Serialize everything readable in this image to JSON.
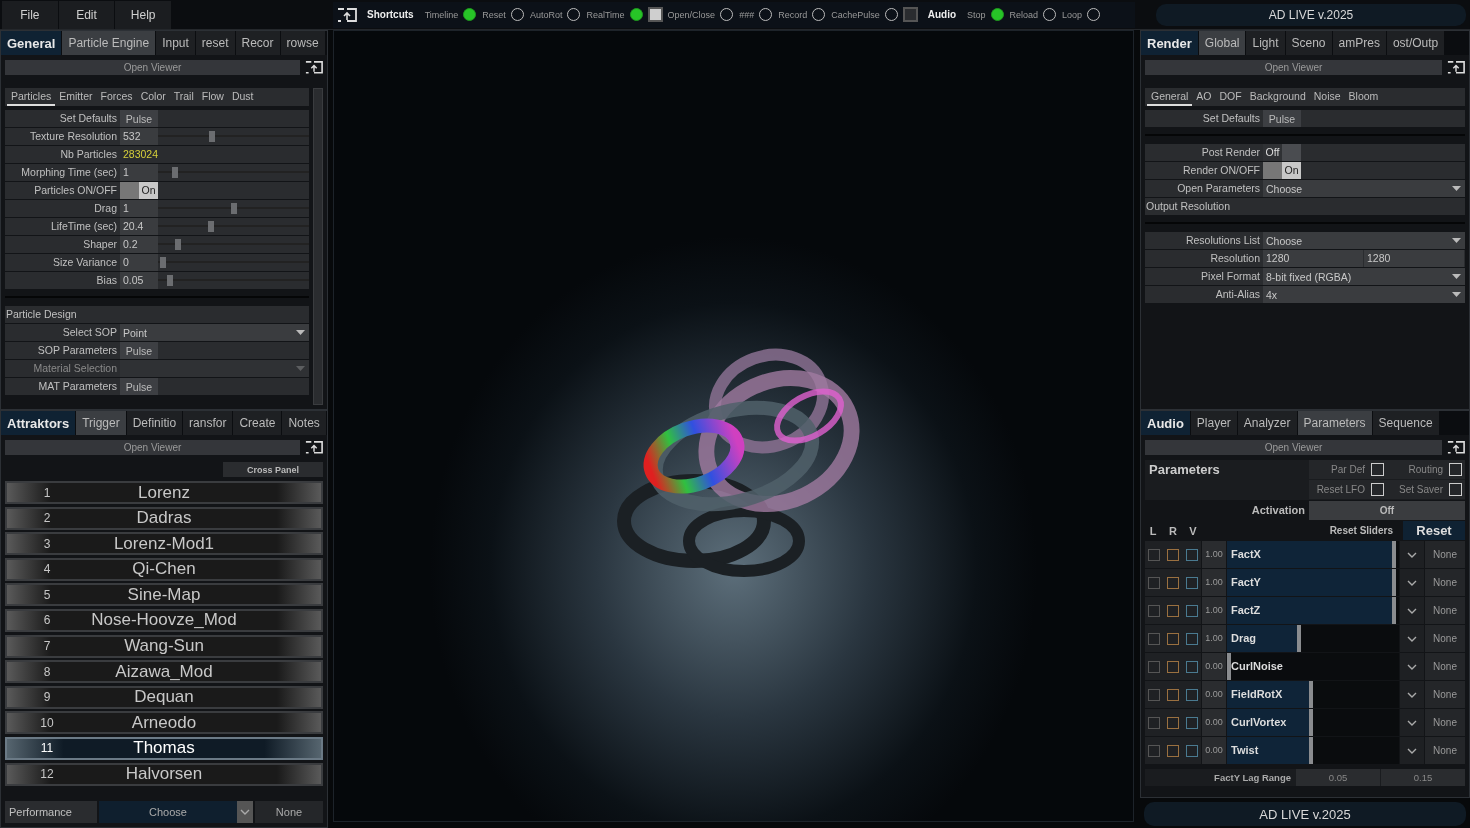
{
  "menu": [
    {
      "label": "File"
    },
    {
      "label": "Edit"
    },
    {
      "label": "Help"
    }
  ],
  "shortcuts": [
    {
      "kind": "heading",
      "label": "Shortcuts"
    },
    {
      "kind": "toggle",
      "label": "Timeline",
      "on": true
    },
    {
      "kind": "toggle",
      "label": "Reset",
      "on": false
    },
    {
      "kind": "toggle",
      "label": "AutoRot",
      "on": false
    },
    {
      "kind": "toggle",
      "label": "RealTime",
      "on": true
    },
    {
      "kind": "square",
      "checked": true
    },
    {
      "kind": "toggle",
      "label": "Open/Close",
      "on": false
    },
    {
      "kind": "toggle",
      "label": "###",
      "on": false
    },
    {
      "kind": "toggle",
      "label": "Record",
      "on": false
    },
    {
      "kind": "toggle",
      "label": "CachePulse",
      "on": false
    },
    {
      "kind": "square",
      "checked": false
    },
    {
      "kind": "heading",
      "label": "Audio"
    },
    {
      "kind": "toggle",
      "label": "Stop",
      "on": true
    },
    {
      "kind": "toggle",
      "label": "Reload",
      "on": false
    },
    {
      "kind": "toggle",
      "label": "Loop",
      "on": false
    }
  ],
  "banner": "AD LIVE v.2025",
  "particle_panel": {
    "title": "General",
    "tabs": [
      {
        "label": "Particle Engine",
        "selected": true
      },
      {
        "label": "Input",
        "selected": false
      },
      {
        "label": "reset",
        "selected": false
      },
      {
        "label": "Recor",
        "selected": false
      },
      {
        "label": "rowse",
        "selected": false
      }
    ],
    "viewer_button": "Open Viewer",
    "subtabs": [
      {
        "label": "Particles",
        "selected": true
      },
      {
        "label": "Emitter",
        "selected": false
      },
      {
        "label": "Forces",
        "selected": false
      },
      {
        "label": "Color",
        "selected": false
      },
      {
        "label": "Trail",
        "selected": false
      },
      {
        "label": "Flow",
        "selected": false
      },
      {
        "label": "Dust",
        "selected": false
      }
    ],
    "groups": [
      [
        {
          "kind": "pulse",
          "label": "Set Defaults",
          "value": "Pulse"
        },
        {
          "kind": "slider",
          "label": "Texture Resolution",
          "value": "532",
          "level": 0.36
        },
        {
          "kind": "readout",
          "label": "Nb Particles",
          "value": "283024"
        },
        {
          "kind": "slider",
          "label": "Morphing Time (sec)",
          "value": "1",
          "level": 0.11
        },
        {
          "kind": "toggle",
          "label": "Particles ON/OFF",
          "value": "On",
          "on": true
        },
        {
          "kind": "slider",
          "label": "Drag",
          "value": "1",
          "level": 0.5
        },
        {
          "kind": "slider",
          "label": "LifeTime (sec)",
          "value": "20.4",
          "level": 0.35
        },
        {
          "kind": "slider",
          "label": "Shaper",
          "value": "0.2",
          "level": 0.13
        },
        {
          "kind": "slider",
          "label": "Size Variance",
          "value": "0",
          "level": 0.03
        },
        {
          "kind": "slider",
          "label": "Bias",
          "value": "0.05",
          "level": 0.08
        }
      ],
      [
        {
          "kind": "section",
          "label": "Particle Design"
        },
        {
          "kind": "dropdown",
          "label": "Select SOP",
          "value": "Point",
          "disabled": false
        },
        {
          "kind": "pulse",
          "label": "SOP Parameters",
          "value": "Pulse"
        },
        {
          "kind": "dropdown",
          "label": "Material Selection",
          "disabled": true
        },
        {
          "kind": "pulse",
          "label": "MAT Parameters",
          "value": "Pulse"
        }
      ]
    ]
  },
  "attractor_panel": {
    "title": "Attraktors",
    "tabs": [
      {
        "label": "Trigger",
        "selected": true
      },
      {
        "label": "Definitio",
        "selected": false
      },
      {
        "label": "ransfor",
        "selected": false
      },
      {
        "label": "Create",
        "selected": false
      },
      {
        "label": "Notes",
        "selected": false
      }
    ],
    "viewer_button": "Open Viewer",
    "cross_panel": "Cross Panel",
    "items": [
      {
        "number": "1",
        "name": "Lorenz",
        "selected": false
      },
      {
        "number": "2",
        "name": "Dadras",
        "selected": false
      },
      {
        "number": "3",
        "name": "Lorenz-Mod1",
        "selected": false
      },
      {
        "number": "4",
        "name": "Qi-Chen",
        "selected": false
      },
      {
        "number": "5",
        "name": "Sine-Map",
        "selected": false
      },
      {
        "number": "6",
        "name": "Nose-Hoovze_Mod",
        "selected": false
      },
      {
        "number": "7",
        "name": "Wang-Sun",
        "selected": false
      },
      {
        "number": "8",
        "name": "Aizawa_Mod",
        "selected": false
      },
      {
        "number": "9",
        "name": "Dequan",
        "selected": false
      },
      {
        "number": "10",
        "name": "Arneodo",
        "selected": false
      },
      {
        "number": "11",
        "name": "Thomas",
        "selected": true
      },
      {
        "number": "12",
        "name": "Halvorsen",
        "selected": false
      }
    ],
    "performance": {
      "label": "Performance",
      "value": "Choose",
      "output": "None"
    }
  },
  "render_panel": {
    "title": "Render",
    "tabs": [
      {
        "label": "Global",
        "selected": true
      },
      {
        "label": "Light",
        "selected": false
      },
      {
        "label": "Sceno",
        "selected": false
      },
      {
        "label": "amPres",
        "selected": false
      },
      {
        "label": "ost/Outp",
        "selected": false
      }
    ],
    "viewer_button": "Open Viewer",
    "subtabs": [
      {
        "label": "General",
        "selected": true
      },
      {
        "label": "AO",
        "selected": false
      },
      {
        "label": "DOF",
        "selected": false
      },
      {
        "label": "Background",
        "selected": false
      },
      {
        "label": "Noise",
        "selected": false
      },
      {
        "label": "Bloom",
        "selected": false
      }
    ],
    "groups": [
      [
        {
          "kind": "pulse",
          "label": "Set Defaults",
          "value": "Pulse"
        }
      ],
      [
        {
          "kind": "toggle",
          "label": "Post Render",
          "value": "Off",
          "on": false
        },
        {
          "kind": "toggle",
          "label": "Render ON/OFF",
          "value": "On",
          "on": true
        },
        {
          "kind": "dropdown",
          "label": "Open Parameters",
          "value": "Choose",
          "disabled": false
        },
        {
          "kind": "section",
          "label": "Output Resolution"
        }
      ],
      [
        {
          "kind": "dropdown",
          "label": "Resolutions List",
          "value": "Choose",
          "disabled": false
        },
        {
          "kind": "pair",
          "label": "Resolution",
          "values": [
            "1280",
            "1280"
          ]
        },
        {
          "kind": "dropdown",
          "label": "Pixel Format",
          "value": "8-bit fixed (RGBA)",
          "disabled": false
        },
        {
          "kind": "dropdown",
          "label": "Anti-Alias",
          "value": "4x",
          "disabled": false
        }
      ]
    ]
  },
  "audio_panel": {
    "title": "Audio",
    "tabs": [
      {
        "label": "Player",
        "selected": false
      },
      {
        "label": "Analyzer",
        "selected": false
      },
      {
        "label": "Parameters",
        "selected": true
      },
      {
        "label": "Sequence",
        "selected": false
      }
    ],
    "viewer_button": "Open Viewer",
    "heading": "Parameters",
    "options": [
      {
        "label": "Par Def",
        "checked": false
      },
      {
        "label": "Routing",
        "checked": false
      },
      {
        "label": "Reset LFO",
        "checked": false
      },
      {
        "label": "Set Saver",
        "checked": false
      }
    ],
    "activation": {
      "label": "Activation",
      "value": "Off"
    },
    "columns": [
      "L",
      "R",
      "V"
    ],
    "reset_sliders": "Reset Sliders",
    "reset": "Reset",
    "params": [
      {
        "name": "FactX",
        "value": "1.00",
        "level": 0.98,
        "lrv": [
          false,
          false,
          false
        ],
        "target": "None"
      },
      {
        "name": "FactY",
        "value": "1.00",
        "level": 0.98,
        "lrv": [
          false,
          false,
          false
        ],
        "target": "None"
      },
      {
        "name": "FactZ",
        "value": "1.00",
        "level": 0.98,
        "lrv": [
          false,
          false,
          false
        ],
        "target": "None"
      },
      {
        "name": "Drag",
        "value": "1.00",
        "level": 0.43,
        "lrv": [
          false,
          false,
          false
        ],
        "target": "None"
      },
      {
        "name": "CurlNoise",
        "value": "0.00",
        "level": 0.0,
        "lrv": [
          false,
          false,
          false
        ],
        "target": "None"
      },
      {
        "name": "FieldRotX",
        "value": "0.00",
        "level": 0.5,
        "lrv": [
          false,
          false,
          false
        ],
        "target": "None"
      },
      {
        "name": "CurlVortex",
        "value": "0.00",
        "level": 0.5,
        "lrv": [
          false,
          false,
          false
        ],
        "target": "None"
      },
      {
        "name": "Twist",
        "value": "0.00",
        "level": 0.5,
        "lrv": [
          false,
          false,
          false
        ],
        "target": "None"
      }
    ],
    "lag_range": {
      "label": "FactY Lag Range",
      "min": "0.05",
      "max": "0.15"
    }
  },
  "footer": "AD LIVE v.2025"
}
